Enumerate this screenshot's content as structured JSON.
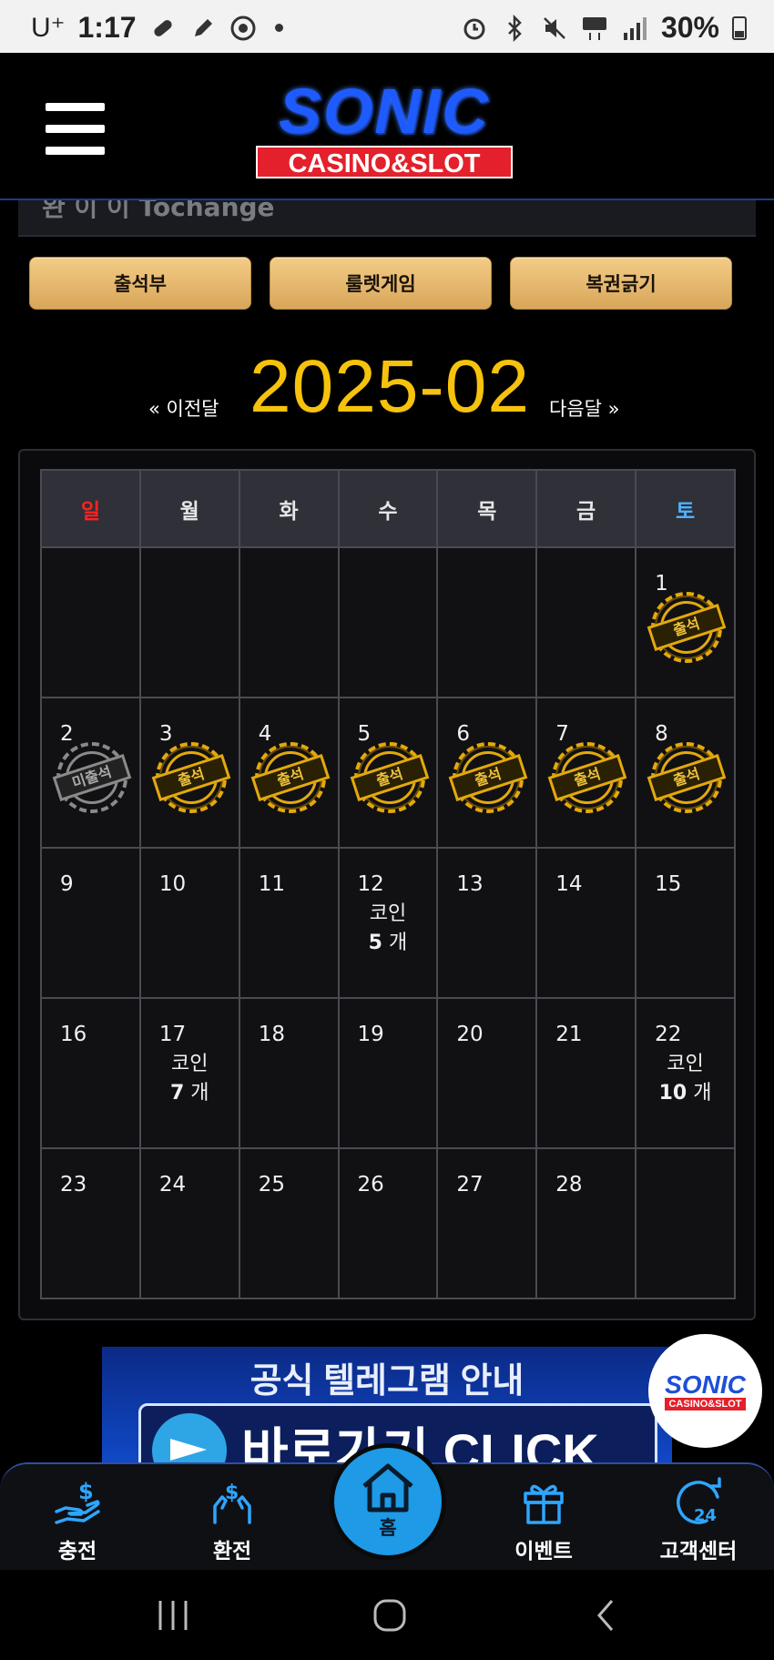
{
  "status_bar": {
    "carrier": "U⁺",
    "time": "1:17",
    "battery": "30%"
  },
  "header": {
    "logo_main": "SONIC",
    "logo_sub": "CASINO&SLOT"
  },
  "strip": {
    "partial_text": "완 이 이 Tochange"
  },
  "tabs": [
    {
      "label": "출석부"
    },
    {
      "label": "룰렛게임"
    },
    {
      "label": "복권긁기"
    }
  ],
  "month_nav": {
    "prev_label": "« 이전달",
    "title": "2025-02",
    "next_label": "다음달 »"
  },
  "calendar": {
    "weekdays": [
      "일",
      "월",
      "화",
      "수",
      "목",
      "금",
      "토"
    ],
    "stamp_attended": "출석",
    "stamp_absent": "미출석",
    "coin_label": "코인",
    "coin_unit": "개",
    "weeks": [
      [
        null,
        null,
        null,
        null,
        null,
        null,
        {
          "day": "1",
          "stamp": "attended"
        }
      ],
      [
        {
          "day": "2",
          "stamp": "absent"
        },
        {
          "day": "3",
          "stamp": "attended"
        },
        {
          "day": "4",
          "stamp": "attended"
        },
        {
          "day": "5",
          "stamp": "attended"
        },
        {
          "day": "6",
          "stamp": "attended"
        },
        {
          "day": "7",
          "stamp": "attended"
        },
        {
          "day": "8",
          "stamp": "attended"
        }
      ],
      [
        {
          "day": "9"
        },
        {
          "day": "10"
        },
        {
          "day": "11"
        },
        {
          "day": "12",
          "coin": "5"
        },
        {
          "day": "13"
        },
        {
          "day": "14"
        },
        {
          "day": "15"
        }
      ],
      [
        {
          "day": "16"
        },
        {
          "day": "17",
          "coin": "7"
        },
        {
          "day": "18"
        },
        {
          "day": "19"
        },
        {
          "day": "20"
        },
        {
          "day": "21"
        },
        {
          "day": "22",
          "coin": "10"
        }
      ],
      [
        {
          "day": "23"
        },
        {
          "day": "24"
        },
        {
          "day": "25"
        },
        {
          "day": "26"
        },
        {
          "day": "27"
        },
        {
          "day": "28"
        },
        null
      ]
    ]
  },
  "banner": {
    "title": "공식 텔레그램 안내",
    "cta": "바로가기 CLICK"
  },
  "float_logo": {
    "main": "SONIC",
    "sub": "CASINO&SLOT"
  },
  "bottom_nav": {
    "items": [
      {
        "label": "충전",
        "icon": "deposit-icon"
      },
      {
        "label": "환전",
        "icon": "withdraw-icon"
      },
      {
        "label": "홈",
        "icon": "home-icon"
      },
      {
        "label": "이벤트",
        "icon": "gift-icon"
      },
      {
        "label": "고객센터",
        "icon": "support-24-icon"
      }
    ]
  },
  "colors": {
    "accent_gold": "#f6c20c",
    "nav_blue": "#1e9ae6",
    "sunday": "#ff2222",
    "saturday": "#4fb2ff"
  }
}
